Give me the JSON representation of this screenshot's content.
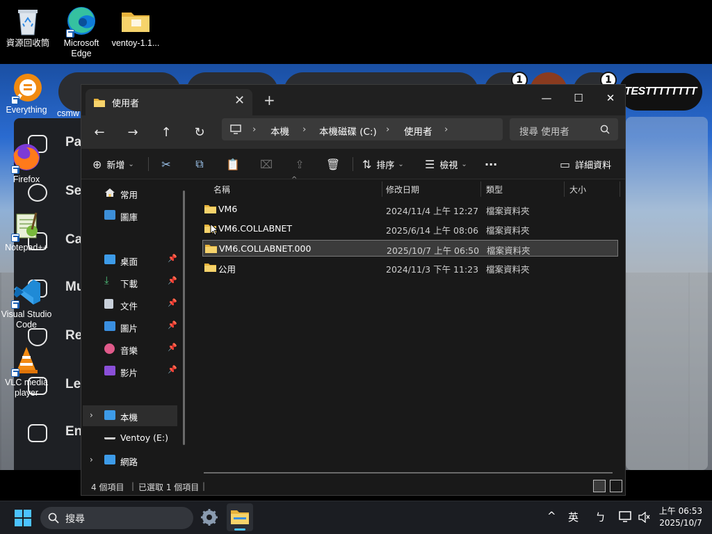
{
  "desktop": {
    "icons": [
      {
        "label": "資源回收筒",
        "icon": "recycle-bin-icon"
      },
      {
        "label": "Microsoft Edge",
        "icon": "edge-icon"
      },
      {
        "label": "ventoy-1.1...",
        "icon": "folder-icon"
      },
      {
        "label": "Everything",
        "icon": "everything-icon"
      },
      {
        "label": "Firefox",
        "icon": "firefox-icon"
      },
      {
        "label": "Notepad++",
        "icon": "notepadpp-icon"
      },
      {
        "label": "Visual Studio Code",
        "icon": "vscode-icon"
      },
      {
        "label": "VLC media player",
        "icon": "vlc-icon"
      }
    ],
    "partial_label": "csmw",
    "background_app": {
      "items": [
        "Pa",
        "Se",
        "Ca",
        "Mu",
        "Re",
        "Le",
        "En"
      ],
      "title_pill": "TESTTTTTTTT",
      "badges": [
        "1",
        "1"
      ]
    }
  },
  "explorer": {
    "tab_title": "使用者",
    "tab_close": "✕",
    "new_tab": "+",
    "window_controls": {
      "minimize": "—",
      "maximize": "☐",
      "close": "✕"
    },
    "nav": {
      "back": "←",
      "forward": "→",
      "up": "↑",
      "refresh": "↻"
    },
    "breadcrumb": [
      "本機",
      "本機磁碟 (C:)",
      "使用者"
    ],
    "breadcrumb_sep": "›",
    "search_placeholder": "搜尋 使用者",
    "toolbar": {
      "new_label": "新增",
      "sort_label": "排序",
      "view_label": "檢視",
      "more": "···",
      "details_label": "詳細資料"
    },
    "sidebar": {
      "quick": [
        {
          "label": "常用",
          "icon": "home-icon"
        },
        {
          "label": "圖庫",
          "icon": "gallery-icon"
        }
      ],
      "pinned": [
        {
          "label": "桌面",
          "icon": "desktop-icon"
        },
        {
          "label": "下載",
          "icon": "download-icon"
        },
        {
          "label": "文件",
          "icon": "documents-icon"
        },
        {
          "label": "圖片",
          "icon": "pictures-icon"
        },
        {
          "label": "音樂",
          "icon": "music-icon"
        },
        {
          "label": "影片",
          "icon": "videos-icon"
        }
      ],
      "drives": [
        {
          "label": "本機",
          "icon": "this-pc-icon"
        },
        {
          "label": "Ventoy (E:)",
          "icon": "drive-icon"
        },
        {
          "label": "網路",
          "icon": "network-icon"
        }
      ]
    },
    "columns": [
      "名稱",
      "修改日期",
      "類型",
      "大小"
    ],
    "files": [
      {
        "name": "VM6",
        "modified": "2024/11/4 上午 12:27",
        "type": "檔案資料夾",
        "size": ""
      },
      {
        "name": "VM6.COLLABNET",
        "modified": "2025/6/14 上午 08:06",
        "type": "檔案資料夾",
        "size": ""
      },
      {
        "name": "VM6.COLLABNET.000",
        "modified": "2025/10/7 上午 06:50",
        "type": "檔案資料夾",
        "size": ""
      },
      {
        "name": "公用",
        "modified": "2024/11/3 下午 11:23",
        "type": "檔案資料夾",
        "size": ""
      }
    ],
    "selected_file_index": 2,
    "status": {
      "count": "4 個項目",
      "selected": "已選取 1 個項目"
    }
  },
  "taskbar": {
    "search_placeholder": "搜尋",
    "ime": "英",
    "clock_time": "上午 06:53",
    "clock_date": "2025/10/7"
  },
  "colors": {
    "accent": "#4cc2ff",
    "folder": "#f2c04b",
    "window_bg": "#191919",
    "taskbar_bg": "#1b1d22"
  }
}
